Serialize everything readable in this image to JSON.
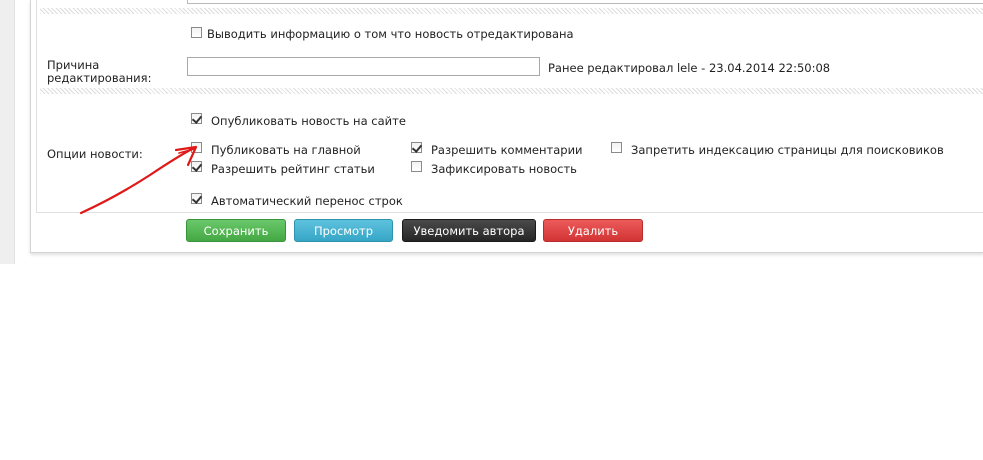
{
  "edit_info_checkbox": {
    "label": "Выводить информацию о том что новость отредактирована",
    "checked": false
  },
  "reason": {
    "label_line1": "Причина",
    "label_line2": "редактирования:",
    "value": "",
    "last_edited": "Ранее редактировал lele - 23.04.2014 22:50:08"
  },
  "options": {
    "label": "Опции новости:",
    "publish_on_site": {
      "label": "Опубликовать новость на сайте",
      "checked": true
    },
    "publish_on_main": {
      "label": "Публиковать на главной",
      "checked": false
    },
    "allow_comments": {
      "label": "Разрешить комментарии",
      "checked": true
    },
    "disallow_indexing": {
      "label": "Запретить индексацию страницы для поисковиков",
      "checked": false
    },
    "allow_rating": {
      "label": "Разрешить рейтинг статьи",
      "checked": true
    },
    "pin_news": {
      "label": "Зафиксировать новость",
      "checked": false
    },
    "auto_wrap": {
      "label": "Автоматический перенос строк",
      "checked": true
    }
  },
  "buttons": {
    "save": "Сохранить",
    "preview": "Просмотр",
    "notify": "Уведомить автора",
    "delete": "Удалить"
  },
  "colors": {
    "save": "#4cb24c",
    "preview": "#3cb0d0",
    "notify": "#2e2e2e",
    "delete": "#dc3e3e",
    "annotation_arrow": "#e01818"
  }
}
